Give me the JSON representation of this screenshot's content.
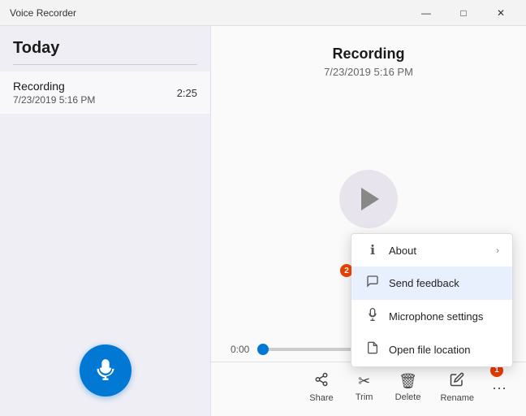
{
  "titlebar": {
    "title": "Voice Recorder",
    "minimize": "—",
    "maximize": "□",
    "close": "✕"
  },
  "sidebar": {
    "header": "Today",
    "items": [
      {
        "name": "Recording",
        "date": "7/23/2019 5:16 PM",
        "duration": "2:25"
      }
    ]
  },
  "main": {
    "recording_title": "Recording",
    "recording_datetime": "7/23/2019 5:16 PM",
    "time_current": "0:00"
  },
  "toolbar": {
    "share_label": "Share",
    "trim_label": "Trim",
    "delete_label": "Delete",
    "rename_label": "Rename",
    "more_label": "..."
  },
  "dropdown": {
    "items": [
      {
        "icon": "ℹ",
        "label": "About",
        "has_chevron": true
      },
      {
        "icon": "💬",
        "label": "Send feedback",
        "has_chevron": false
      },
      {
        "icon": "🎤",
        "label": "Microphone settings",
        "has_chevron": false
      },
      {
        "icon": "📄",
        "label": "Open file location",
        "has_chevron": false
      }
    ]
  },
  "badges": {
    "badge1": "1",
    "badge2": "2"
  }
}
